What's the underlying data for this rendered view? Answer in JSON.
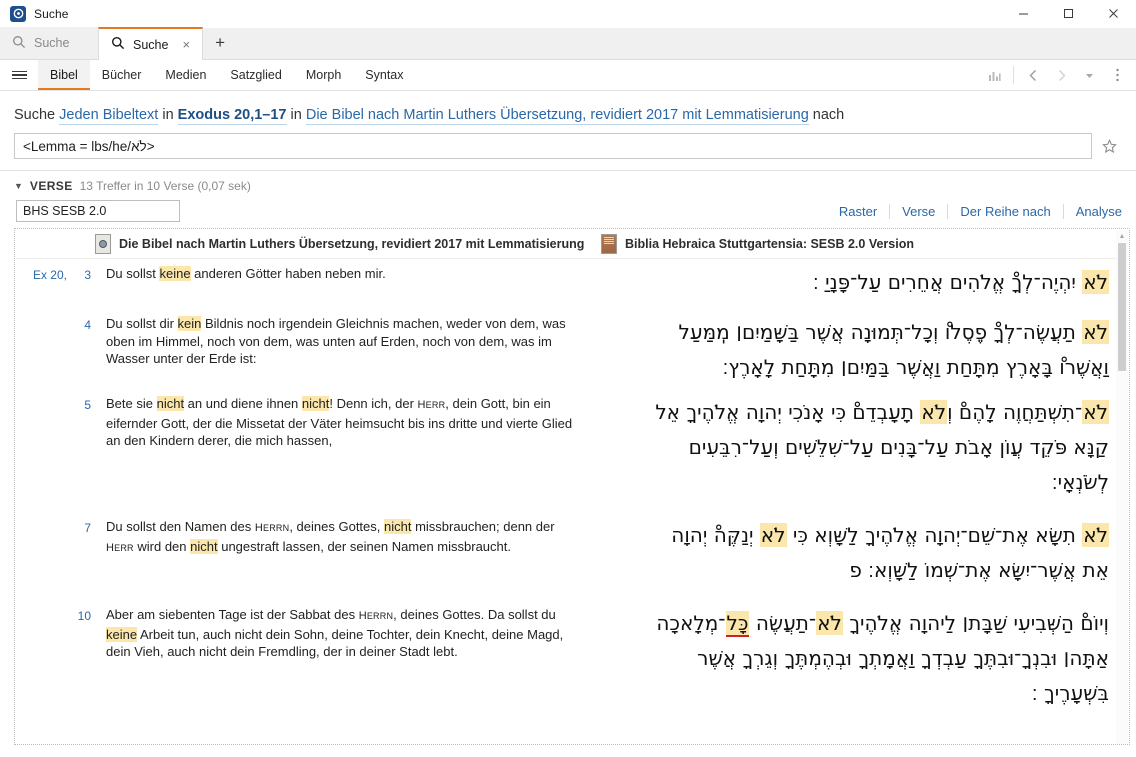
{
  "window": {
    "title": "Suche",
    "app_icon": "logos-app-icon",
    "minimize": "minimize-icon",
    "maximize": "maximize-icon",
    "close": "close-icon"
  },
  "tabs": [
    {
      "label": "Suche",
      "icon": "search-icon",
      "active": false
    },
    {
      "label": "Suche",
      "icon": "search-icon",
      "active": true,
      "close": "×"
    }
  ],
  "newtab_label": "+",
  "menubar": {
    "hamburger": "hamburger-icon",
    "items": [
      {
        "label": "Bibel",
        "active": true
      },
      {
        "label": "Bücher",
        "active": false
      },
      {
        "label": "Medien",
        "active": false
      },
      {
        "label": "Satzglied",
        "active": false
      },
      {
        "label": "Morph",
        "active": false
      },
      {
        "label": "Syntax",
        "active": false
      }
    ],
    "right_icons": [
      "bar-chart-icon",
      "back-arrow-icon",
      "forward-arrow-icon",
      "history-dropdown-icon",
      "overflow-menu-icon"
    ]
  },
  "query_line": {
    "prefix": "Suche",
    "scope_link": "Jeden Bibeltext",
    "in1": "in",
    "passage_link": "Exodus 20,1–17",
    "in2": "in",
    "resource_link": "Die Bibel nach Martin Luthers Übersetzung, revidiert 2017 mit Lemmatisierung",
    "suffix": "nach"
  },
  "search_input": {
    "value": "<Lemma = lbs/he/לֹא>",
    "placeholder": "Suche",
    "favorite_icon": "star-icon"
  },
  "results_header": {
    "expand_icon": "caret-down-icon",
    "label": "VERSE",
    "meta": "13 Treffer in 10 Verse (0,07 sek)"
  },
  "resource_selector": {
    "value": "BHS SESB 2.0"
  },
  "view_links": [
    "Raster",
    "Verse",
    "Der Reihe nach",
    "Analyse"
  ],
  "columns": [
    {
      "icon": "grey-book-icon",
      "title": "Die Bibel nach Martin Luthers Übersetzung, revidiert 2017 mit Lemmatisierung"
    },
    {
      "icon": "brown-book-icon",
      "title": "Biblia Hebraica Stuttgartensia: SESB 2.0 Version"
    }
  ],
  "verses": [
    {
      "ref": "Ex 20,",
      "num": "3",
      "german": [
        {
          "t": "Du sollst "
        },
        {
          "t": "keine",
          "hl": true
        },
        {
          "t": " anderen Götter haben neben mir."
        }
      ],
      "hebrew_lines": [
        [
          {
            "t": "לֹא",
            "hl": true
          },
          {
            "t": " יִהְיֶה־לְךָْ אֱלֹהִים אֲחֵרִים עַל־פָּנָיַ ׃"
          }
        ]
      ]
    },
    {
      "ref": "",
      "num": "4",
      "german": [
        {
          "t": "Du sollst dir "
        },
        {
          "t": "kein",
          "hl": true
        },
        {
          "t": " Bildnis noch irgendein Gleichnis machen, weder von dem, was oben im Himmel, noch von dem, was unten auf Erden, noch von dem, was im Wasser unter der Erde ist:"
        }
      ],
      "hebrew_lines": [
        [
          {
            "t": "לֹא",
            "hl": true
          },
          {
            "t": " תַעֲשֶׂה־לְךָْ פֵֶסֶלוْ וְכָל־תְּמוּנָה אֲשֶׁר בַּשָּׁמַיִם׀ מִֽמַּעַל"
          }
        ],
        [
          {
            "t": "וַאֲשֶׁרוْ בָּאָרֶץ מִתָּחַת וַאֲשֶׁר בַּמַּיִם׀ מִתָּחַת לָאָרֶץ׃"
          }
        ]
      ]
    },
    {
      "ref": "",
      "num": "5",
      "german": [
        {
          "t": "Bete sie "
        },
        {
          "t": "nicht",
          "hl": true
        },
        {
          "t": " an und diene ihnen "
        },
        {
          "t": "nicht",
          "hl": true
        },
        {
          "t": "! Denn ich, der "
        },
        {
          "t": "Herr",
          "sc": true
        },
        {
          "t": ", dein Gott, bin ein eifernder Gott, der die Missetat der Väter heimsucht bis ins dritte und vierte Glied an den Kindern derer, die mich hassen,"
        }
      ],
      "hebrew_lines": [
        [
          {
            "t": "לֹא",
            "hl": true
          },
          {
            "t": "־תִשְׁתַּחֲוֶה לָהֶםْ וְ"
          },
          {
            "t": "לֹא",
            "hl": true
          },
          {
            "t": " תָעָבְדֵםْ כִּי אָנֹכִי יְהוָה אֱלֹהֶיךָ אֵל"
          }
        ],
        [
          {
            "t": "קַנָּא פֹּקֵד עֲוֹן אָבֹת עַל־בָּנִים עַל־שִׁלֵּשִׁים וְעַל־רִבֵּעִים"
          }
        ],
        [
          {
            "t": "לְשֹׂנְאָי׃"
          }
        ]
      ]
    },
    {
      "ref": "",
      "num": "7",
      "german": [
        {
          "t": "Du sollst den Namen des "
        },
        {
          "t": "Herrn",
          "sc": true
        },
        {
          "t": ", deines Gottes, "
        },
        {
          "t": "nicht",
          "hl": true
        },
        {
          "t": " missbrauchen; denn der "
        },
        {
          "t": "Herr",
          "sc": true
        },
        {
          "t": " wird den "
        },
        {
          "t": "nicht",
          "hl": true
        },
        {
          "t": " ungestraft lassen, der seinen Namen missbraucht."
        }
      ],
      "hebrew_lines": [
        [
          {
            "t": "לֹא",
            "hl": true
          },
          {
            "t": " תִשָּׂא אֶת־שֵׁם־יְהוָה אֱלֹהֶיךָ לַשָּׁוְא כִּי "
          },
          {
            "t": "לֹא",
            "hl": true
          },
          {
            "t": " יְנַקֶּהْ יְהוָה"
          }
        ],
        [
          {
            "t": "אֵת אֲשֶׁר־יִשָּׂא אֶת־שְׁמוֹ לַשָּׁוְא׃ פ"
          }
        ]
      ]
    },
    {
      "ref": "",
      "num": "10",
      "german": [
        {
          "t": "Aber am siebenten Tage ist der Sabbat des "
        },
        {
          "t": "Herrn",
          "sc": true
        },
        {
          "t": ", deines Gottes. Da sollst du "
        },
        {
          "t": "keine",
          "hl": true
        },
        {
          "t": " Arbeit tun, auch nicht dein Sohn, deine Tochter, dein Knecht, deine Magd, dein Vieh, auch nicht dein Fremdling, der in deiner Stadt lebt."
        }
      ],
      "hebrew_lines": [
        [
          {
            "t": "וְיוֹםْ הַשְּׁבִיעִי שַׁבָּת׀ לַיהוָה אֱלֹהֶיךָ "
          },
          {
            "t": "לֹא",
            "hl": true
          },
          {
            "t": "־תַעֲשֶׂה "
          },
          {
            "t": "כָּל",
            "hl": true,
            "ul": true
          },
          {
            "t": "־מְלָאכָה"
          }
        ],
        [
          {
            "t": "אַתָּה׀ וּבִנְךָ־וּבִתֶּךָ עַבְדְךָ וַאֲמָתְךָ וּבְהֶמְתֶּךָ וְגֵרְךָ אֲשֶׁר"
          }
        ],
        [
          {
            "t": "בִּשְׁעָרֶיךָ ׃"
          }
        ]
      ]
    }
  ],
  "colors": {
    "accent_orange": "#e07b20",
    "link_blue": "#2a68a8",
    "highlight_yellow": "#fbe7ab",
    "underline_red": "#cc2222"
  }
}
